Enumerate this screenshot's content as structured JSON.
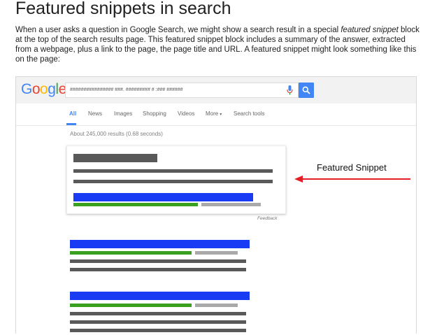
{
  "page_title": "Featured snippets in search",
  "intro": {
    "before_italic": "When a user asks a question in Google Search, we might show a search result in a special ",
    "italic": "featured snippet",
    "after_italic": " block at the top of the search results page. This featured snippet block includes a summary of the answer, extracted from a webpage, plus a link to the page, the page title and URL. A featured snippet might look something like this on the page:"
  },
  "google": {
    "logo_letters": [
      "G",
      "o",
      "o",
      "g",
      "l",
      "e"
    ],
    "search_query": "################ ###. ######### # :### ######",
    "tabs": [
      "All",
      "News",
      "Images",
      "Shopping",
      "Videos",
      "More",
      "Search tools"
    ],
    "more_caret": "▾",
    "results_count": "About 245,000 results (0.68 seconds)",
    "feedback": "Feedback"
  },
  "annotation": {
    "label": "Featured Snippet",
    "arrow_color": "#e41e26"
  },
  "colors": {
    "link_blue": "#1a3bf4",
    "url_green": "#3aa120",
    "text_dark": "#595959",
    "text_gray": "#a9a9a9",
    "google_blue": "#4285f4"
  }
}
